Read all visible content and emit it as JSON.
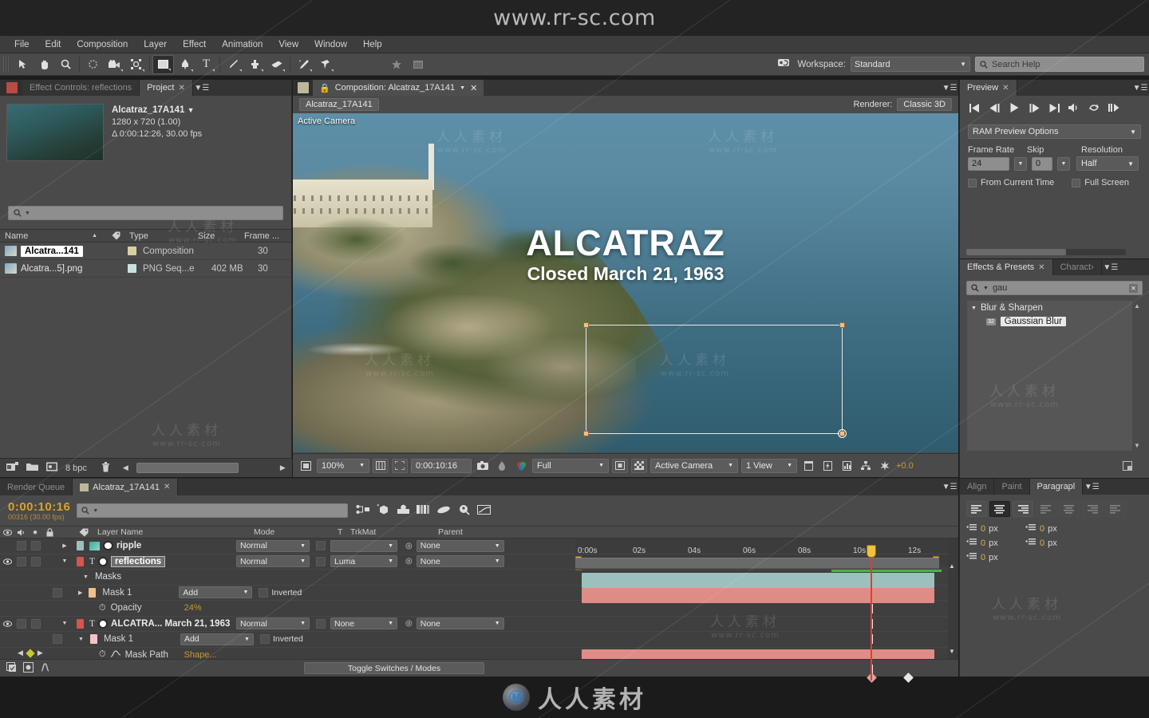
{
  "watermark": {
    "top": "www.rr-sc.com",
    "bottom_cn": "人人素材",
    "overlay_cn": "人人素材",
    "overlay_url": "www.rr-sc.com"
  },
  "menu": {
    "items": [
      "File",
      "Edit",
      "Composition",
      "Layer",
      "Effect",
      "Animation",
      "View",
      "Window",
      "Help"
    ]
  },
  "toolbar": {
    "tools": [
      {
        "name": "selection-tool",
        "glyph": "➤"
      },
      {
        "name": "hand-tool",
        "glyph": "✋"
      },
      {
        "name": "zoom-tool",
        "glyph": "🔍"
      },
      {
        "name": "rotation-tool",
        "glyph": "↻"
      },
      {
        "name": "camera-tool",
        "glyph": "🎥"
      },
      {
        "name": "pan-behind-tool",
        "glyph": "✣"
      },
      {
        "name": "shape-tool",
        "glyph": "■"
      },
      {
        "name": "pen-tool",
        "glyph": "✒"
      },
      {
        "name": "type-tool",
        "glyph": "T"
      },
      {
        "name": "brush-tool",
        "glyph": "╱"
      },
      {
        "name": "clone-stamp-tool",
        "glyph": "⚙"
      },
      {
        "name": "eraser-tool",
        "glyph": "▱"
      },
      {
        "name": "roto-brush-tool",
        "glyph": "✎"
      },
      {
        "name": "puppet-pin-tool",
        "glyph": "📌"
      }
    ],
    "workspace_label": "Workspace:",
    "workspace_value": "Standard",
    "search_help_placeholder": "Search Help"
  },
  "project": {
    "tabs": [
      {
        "label": "Effect Controls: reflections",
        "active": false,
        "closable": false
      },
      {
        "label": "Project",
        "active": true,
        "closable": true
      }
    ],
    "item_name": "Alcatraz_17A141",
    "dimensions": "1280 x 720 (1.00)",
    "duration": "Δ 0:00:12:26, 30.00 fps",
    "search_placeholder": "",
    "columns": [
      "Name",
      "Type",
      "Size",
      "Frame ..."
    ],
    "rows": [
      {
        "name": "Alcatra...141",
        "type": "Composition",
        "size": "",
        "frame": "30",
        "color": "#d8cfa4",
        "selected": true
      },
      {
        "name": "Alcatra...5].png",
        "type": "PNG Seq...e",
        "size": "402 MB",
        "frame": "30",
        "color": "#c7e3e0",
        "selected": false
      }
    ],
    "footer": {
      "bpc": "8 bpc"
    }
  },
  "composition": {
    "tab_label": "Composition: Alcatraz_17A141",
    "comp_chip": "Alcatraz_17A141",
    "renderer_label": "Renderer:",
    "renderer_value": "Classic 3D",
    "view_label": "Active Camera",
    "title_main": "ALCATRAZ",
    "title_sub": "Closed March 21, 1963",
    "footer": {
      "zoom": "100%",
      "time": "0:00:10:16",
      "resolution": "Full",
      "camera": "Active Camera",
      "views": "1 View",
      "exposure": "+0.0"
    }
  },
  "preview": {
    "tabs": [
      {
        "label": "Preview",
        "active": true,
        "closable": true
      }
    ],
    "transport": [
      "first-frame",
      "prev-frame",
      "play",
      "next-frame",
      "last-frame",
      "audio",
      "loop",
      "ram-preview"
    ],
    "ram_preview_options": "RAM Preview Options",
    "frame_rate_label": "Frame Rate",
    "frame_rate_value": "24",
    "skip_label": "Skip",
    "skip_value": "0",
    "resolution_label": "Resolution",
    "resolution_value": "Half",
    "from_current_time": "From Current Time",
    "full_screen": "Full Screen"
  },
  "effects": {
    "tabs": [
      {
        "label": "Effects & Presets",
        "active": true,
        "closable": true
      },
      {
        "label": "Charact›",
        "active": false,
        "closable": false
      }
    ],
    "search_value": "gau",
    "category": "Blur & Sharpen",
    "items": [
      {
        "label": "Gaussian Blur",
        "badge": "32"
      }
    ]
  },
  "paragraph": {
    "tabs": [
      {
        "label": "Align",
        "active": false
      },
      {
        "label": "Paint",
        "active": false
      },
      {
        "label": "Paragrapl",
        "active": true
      }
    ],
    "align_buttons": [
      "align-left",
      "align-center",
      "align-right",
      "justify-last-left",
      "justify-last-center",
      "justify-last-right",
      "justify-all"
    ],
    "active_align_index": 1,
    "fields": [
      {
        "name": "indent-left",
        "value": "0",
        "unit": "px"
      },
      {
        "name": "indent-right",
        "value": "0",
        "unit": "px"
      },
      {
        "name": "indent-first-line",
        "value": "0",
        "unit": "px"
      },
      {
        "name": "space-before",
        "value": "0",
        "unit": "px"
      },
      {
        "name": "space-after",
        "value": "0",
        "unit": "px"
      }
    ]
  },
  "timeline": {
    "tabs": [
      {
        "label": "Render Queue",
        "active": false,
        "closable": false
      },
      {
        "label": "Alcatraz_17A141",
        "active": true,
        "closable": true
      }
    ],
    "current_time": "0:00:10:16",
    "current_frame": "00316 (30.00 fps)",
    "search_placeholder": "",
    "columns": [
      "Layer Name",
      "Mode",
      "T",
      "TrkMat",
      "Parent"
    ],
    "ruler_ticks": [
      "0:00s",
      "02s",
      "04s",
      "06s",
      "08s",
      "10s",
      "12s"
    ],
    "toggle_switches_label": "Toggle Switches / Modes",
    "layers": [
      {
        "kind": "layer",
        "name": "ripple",
        "mode": "Normal",
        "trkmat": "",
        "parent": "None",
        "color": "#9cc1bc",
        "eye": false,
        "bar": "teal",
        "bold": true
      },
      {
        "kind": "layer",
        "name": "reflections",
        "mode": "Normal",
        "trkmat": "Luma",
        "parent": "None",
        "color": "#d9534f",
        "eye": true,
        "bar": "red",
        "selected": true
      },
      {
        "kind": "group",
        "name": "Masks"
      },
      {
        "kind": "mask",
        "name": "Mask 1",
        "mode": "Add",
        "inverted": "Inverted",
        "color": "#f0c08a"
      },
      {
        "kind": "prop",
        "name": "Opacity",
        "value": "24%"
      },
      {
        "kind": "layer",
        "name": "ALCATRA... March 21, 1963",
        "mode": "Normal",
        "trkmat": "None",
        "parent": "None",
        "color": "#d9534f",
        "eye": true,
        "bar": "red",
        "bold": true
      },
      {
        "kind": "mask",
        "name": "Mask 1",
        "mode": "Add",
        "inverted": "Inverted",
        "color": "#f3c3c9"
      },
      {
        "kind": "prop",
        "name": "Mask Path",
        "value": "Shape..."
      }
    ]
  }
}
